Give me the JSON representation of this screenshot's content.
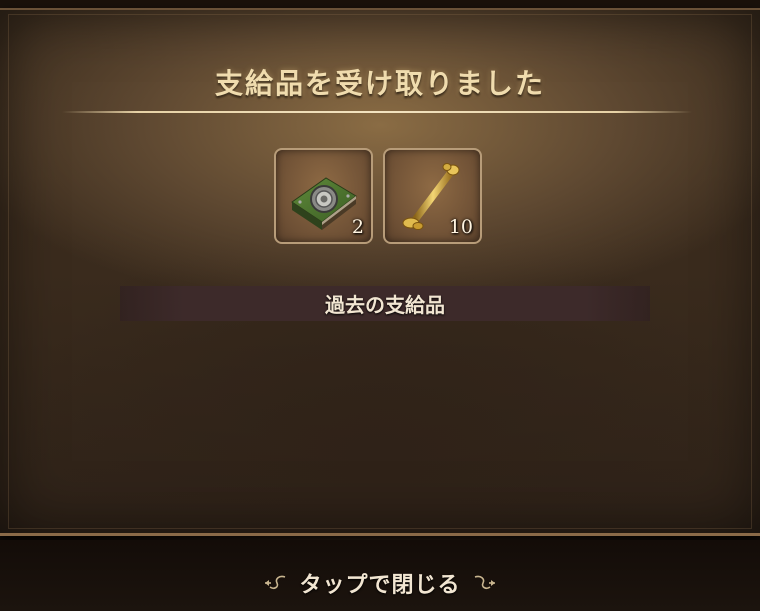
{
  "dialog": {
    "title": "支給品を受け取りました",
    "items": [
      {
        "icon": "green-book-icon",
        "quantity": "2"
      },
      {
        "icon": "golden-bone-icon",
        "quantity": "10"
      }
    ],
    "history_label": "過去の支給品"
  },
  "footer": {
    "close_label": "タップで閉じる"
  },
  "colors": {
    "title_gold": "#f0dcae",
    "panel_brown": "#3e2f20",
    "slot_border": "#b79c79",
    "history_bar": "#3d2a2a"
  }
}
